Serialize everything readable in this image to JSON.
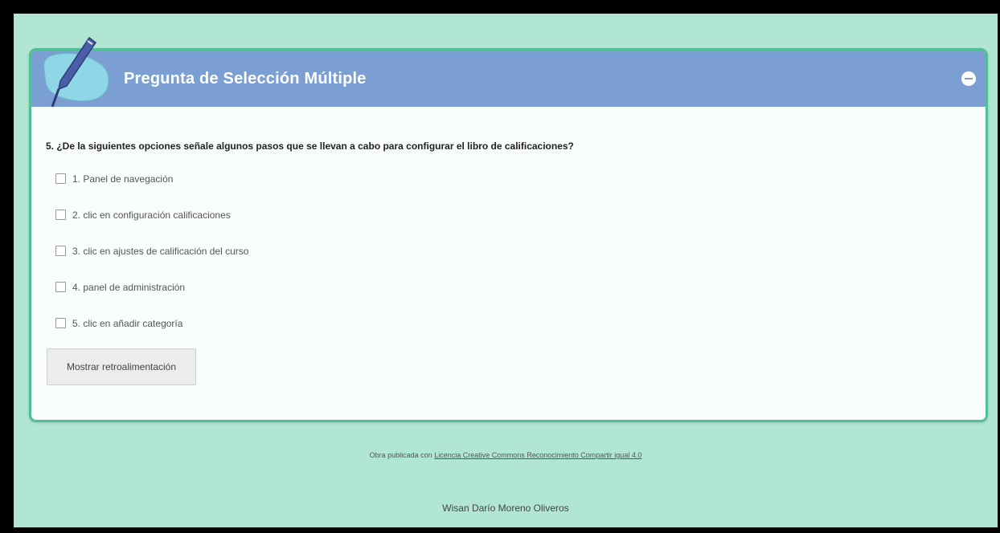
{
  "idevice": {
    "title": "Pregunta de Selección Múltiple",
    "icon": "pencil-icon",
    "toggle_icon": "minus-circle-icon"
  },
  "question": {
    "text": "5. ¿De la siguientes opciones señale algunos pasos que se llevan a cabo para configurar el libro de calificaciones?",
    "options": [
      {
        "label": "1. Panel de navegación",
        "checked": false
      },
      {
        "label": "2. clic en configuración calificaciones",
        "checked": false
      },
      {
        "label": "3. clic en ajustes de calificación del curso",
        "checked": false
      },
      {
        "label": "4. panel de administración",
        "checked": false
      },
      {
        "label": "5. clic en añadir categoría",
        "checked": false
      }
    ],
    "feedback_button_label": "Mostrar retroalimentación"
  },
  "footer": {
    "license_prefix": "Obra publicada con",
    "license_link": "Licencia Creative Commons Reconocimiento Compartir igual 4.0",
    "author": "Wisan Darío Moreno Oliveros"
  },
  "colors": {
    "page_background": "#b1e6d2",
    "header_background": "#7b9fd3",
    "border": "#4fbf95"
  }
}
